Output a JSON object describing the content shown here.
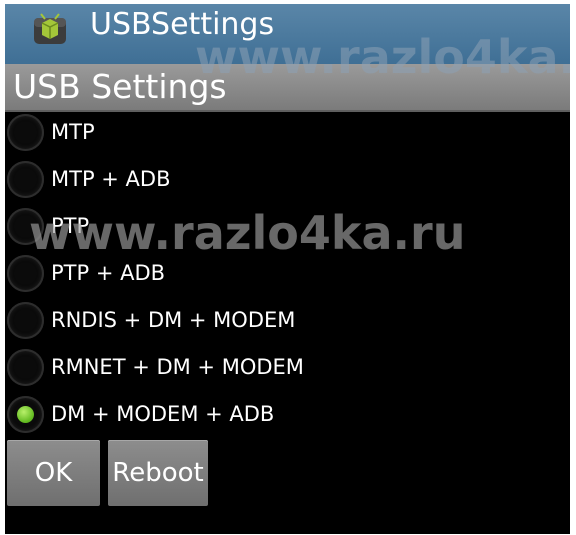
{
  "app": {
    "title": "USBSettings",
    "icon": "android-app-icon"
  },
  "dialog": {
    "title": "USB Settings"
  },
  "options": [
    {
      "label": "MTP",
      "checked": false
    },
    {
      "label": "MTP + ADB",
      "checked": false
    },
    {
      "label": "PTP",
      "checked": false
    },
    {
      "label": "PTP + ADB",
      "checked": false
    },
    {
      "label": "RNDIS + DM + MODEM",
      "checked": false
    },
    {
      "label": "RMNET + DM + MODEM",
      "checked": false
    },
    {
      "label": "DM + MODEM + ADB",
      "checked": true
    }
  ],
  "buttons": {
    "ok": "OK",
    "reboot": "Reboot"
  },
  "watermark": {
    "top": "www.razlo4ka.ru",
    "middle": "www.razlo4ka.ru"
  },
  "colors": {
    "titlebar": "#4a7aa0",
    "dialog_header": "#8a8a8a",
    "radio_checked": "#7ed33a",
    "background": "#000000"
  }
}
